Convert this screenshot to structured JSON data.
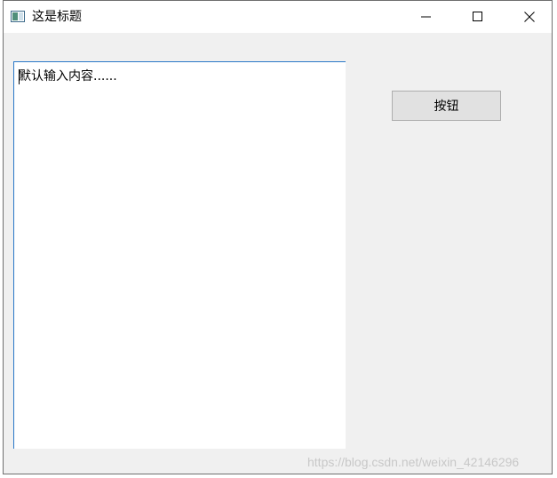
{
  "window": {
    "title": "这是标题",
    "icon": "app-window-icon"
  },
  "caption_buttons": {
    "minimize_icon": "minimize-icon",
    "maximize_icon": "maximize-icon",
    "close_icon": "close-icon"
  },
  "editor": {
    "value": "默认输入内容......"
  },
  "button": {
    "label": "按钮"
  },
  "watermark": {
    "text": "https://blog.csdn.net/weixin_42146296"
  },
  "colors": {
    "window_background": "#f0f0f0",
    "titlebar_background": "#ffffff",
    "editor_border": "#2a78c8",
    "button_background": "#e1e1e1",
    "button_border": "#adadad",
    "watermark": "#c8c8c8"
  }
}
